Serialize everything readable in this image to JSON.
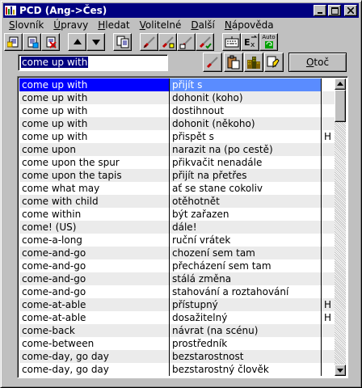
{
  "window": {
    "title": "PCD (Ang->Čes)"
  },
  "title_buttons": [
    "minimize-icon",
    "maximize-icon",
    "close-icon"
  ],
  "menu": [
    {
      "first": "S",
      "rest": "lovník"
    },
    {
      "first": "Ú",
      "rest": "pravy"
    },
    {
      "first": "H",
      "rest": "ledat"
    },
    {
      "first": "V",
      "rest": "olitelné"
    },
    {
      "first": "D",
      "rest": "alší"
    },
    {
      "first": "N",
      "rest": "ápověda"
    }
  ],
  "toolbar": {
    "auto_label": "Auto"
  },
  "search": {
    "value": "come up with"
  },
  "translate_button": {
    "first": "O",
    "rest": "toč"
  },
  "colors": {
    "titlebar": "#000080",
    "selection": "#0000ff",
    "selection_secondary": "#5a8cff",
    "stripe": "#ebebeb"
  },
  "entries": [
    {
      "en": "come up with",
      "cs": "přijít s",
      "flag": ""
    },
    {
      "en": "come up with",
      "cs": "dohonit (koho)",
      "flag": ""
    },
    {
      "en": "come up with",
      "cs": "dostihnout",
      "flag": ""
    },
    {
      "en": "come up with",
      "cs": "dohonit (někoho)",
      "flag": ""
    },
    {
      "en": "come up with",
      "cs": "přispět s",
      "flag": "H"
    },
    {
      "en": "come upon",
      "cs": "narazit na (po cestě)",
      "flag": ""
    },
    {
      "en": "come upon the spur",
      "cs": "přikvačit nenadále",
      "flag": ""
    },
    {
      "en": "come upon the tapis",
      "cs": "přijít na přetřes",
      "flag": ""
    },
    {
      "en": "come what may",
      "cs": "ať se stane cokoliv",
      "flag": ""
    },
    {
      "en": "come with child",
      "cs": "otěhotnět",
      "flag": ""
    },
    {
      "en": "come within",
      "cs": "být zařazen",
      "flag": ""
    },
    {
      "en": "come! (US)",
      "cs": "dále!",
      "flag": ""
    },
    {
      "en": "come-a-long",
      "cs": "ruční vrátek",
      "flag": ""
    },
    {
      "en": "come-and-go",
      "cs": "chození sem tam",
      "flag": ""
    },
    {
      "en": "come-and-go",
      "cs": "přecházení sem tam",
      "flag": ""
    },
    {
      "en": "come-and-go",
      "cs": "stálá změna",
      "flag": ""
    },
    {
      "en": "come-and-go",
      "cs": "stahování a roztahování",
      "flag": ""
    },
    {
      "en": "come-at-able",
      "cs": "přístupný",
      "flag": "H"
    },
    {
      "en": "come-at-able",
      "cs": "dosažitelný",
      "flag": "H"
    },
    {
      "en": "come-back",
      "cs": "návrat (na scénu)",
      "flag": ""
    },
    {
      "en": "come-between",
      "cs": "prostředník",
      "flag": ""
    },
    {
      "en": "come-day, go day",
      "cs": "bezstarostnost",
      "flag": ""
    },
    {
      "en": "come-day, go day",
      "cs": "bezstarostný člověk",
      "flag": ""
    }
  ]
}
